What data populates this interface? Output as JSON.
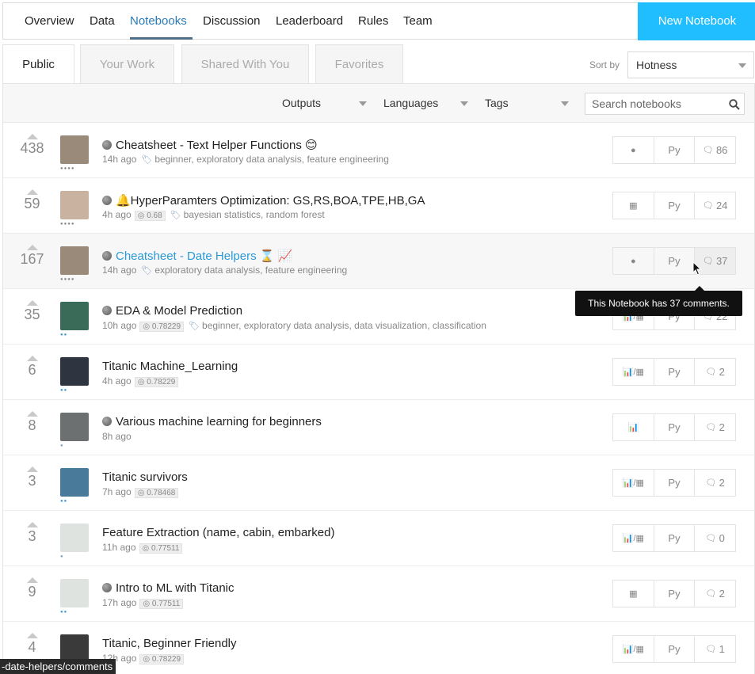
{
  "nav": {
    "items": [
      "Overview",
      "Data",
      "Notebooks",
      "Discussion",
      "Leaderboard",
      "Rules",
      "Team"
    ],
    "active": "Notebooks",
    "new_notebook_label": "New Notebook"
  },
  "tabs": {
    "items": [
      "Public",
      "Your Work",
      "Shared With You",
      "Favorites"
    ],
    "active": "Public",
    "sort_by_label": "Sort by",
    "sort_value": "Hotness"
  },
  "filters": {
    "outputs_label": "Outputs",
    "languages_label": "Languages",
    "tags_label": "Tags",
    "search_placeholder": "Search notebooks"
  },
  "notebooks": [
    {
      "votes": "438",
      "title": "Cheatsheet - Text Helper Functions 😊",
      "kernel_dot": true,
      "time": "14h ago",
      "score": "",
      "tags": "beginner, exploratory data analysis, feature engineering",
      "output_glyph": "●",
      "language": "Py",
      "comments": "86",
      "avatar_color": "#9a8a7a",
      "dots": "●●●●",
      "dots_color": "#888888"
    },
    {
      "votes": "59",
      "title": "🔔HyperParamters Optimization: GS,RS,BOA,TPE,HB,GA",
      "kernel_dot": true,
      "time": "4h ago",
      "score": "0.68",
      "tags": "bayesian statistics, random forest",
      "output_glyph": "▦",
      "language": "Py",
      "comments": "24",
      "avatar_color": "#c9b3a0",
      "dots": "●●●●",
      "dots_color": "#888888"
    },
    {
      "votes": "167",
      "title": "Cheatsheet - Date Helpers ⌛ 📈",
      "kernel_dot": true,
      "time": "14h ago",
      "score": "",
      "tags": "exploratory data analysis, feature engineering",
      "output_glyph": "●",
      "language": "Py",
      "comments": "37",
      "avatar_color": "#9a8a7a",
      "dots": "●●●●",
      "dots_color": "#888888"
    },
    {
      "votes": "35",
      "title": "EDA & Model Prediction",
      "kernel_dot": true,
      "time": "10h ago",
      "score": "0.78229",
      "tags": "beginner, exploratory data analysis, data visualization, classification",
      "output_glyph": "📊/▦",
      "language": "Py",
      "comments": "22",
      "avatar_color": "#3a6a58",
      "dots": "●●",
      "dots_color": "#3b9ad9"
    },
    {
      "votes": "6",
      "title": "Titanic Machine_Learning",
      "kernel_dot": false,
      "time": "4h ago",
      "score": "0.78229",
      "tags": "",
      "output_glyph": "📊/▦",
      "language": "Py",
      "comments": "2",
      "avatar_color": "#2f3540",
      "dots": "●●",
      "dots_color": "#3b9ad9"
    },
    {
      "votes": "8",
      "title": "Various machine learning for beginners",
      "kernel_dot": true,
      "time": "8h ago",
      "score": "",
      "tags": "",
      "output_glyph": "📊",
      "language": "Py",
      "comments": "2",
      "avatar_color": "#6d7070",
      "dots": "●",
      "dots_color": "#7aa0cc"
    },
    {
      "votes": "3",
      "title": "Titanic survivors",
      "kernel_dot": false,
      "time": "7h ago",
      "score": "0.78468",
      "tags": "",
      "output_glyph": "📊/▦",
      "language": "Py",
      "comments": "2",
      "avatar_color": "#4a7a9a",
      "dots": "●●",
      "dots_color": "#3b9ad9"
    },
    {
      "votes": "3",
      "title": "Feature Extraction (name, cabin, embarked)",
      "kernel_dot": false,
      "time": "11h ago",
      "score": "0.77511",
      "tags": "",
      "output_glyph": "📊/▦",
      "language": "Py",
      "comments": "0",
      "avatar_color": "#dfe3df",
      "dots": "●",
      "dots_color": "#7aa0cc"
    },
    {
      "votes": "9",
      "title": "Intro to ML with Titanic",
      "kernel_dot": true,
      "time": "17h ago",
      "score": "0.77511",
      "tags": "",
      "output_glyph": "▦",
      "language": "Py",
      "comments": "2",
      "avatar_color": "#dfe3df",
      "dots": "●●",
      "dots_color": "#3b9ad9"
    },
    {
      "votes": "4",
      "title": "Titanic, Beginner Friendly",
      "kernel_dot": false,
      "time": "12h ago",
      "score": "0.78229",
      "tags": "",
      "output_glyph": "📊/▦",
      "language": "Py",
      "comments": "1",
      "avatar_color": "#3a3a3a",
      "dots": "",
      "dots_color": "#888888"
    }
  ],
  "tooltip": "This Notebook has 37 comments.",
  "status_bar": "-date-helpers/comments"
}
